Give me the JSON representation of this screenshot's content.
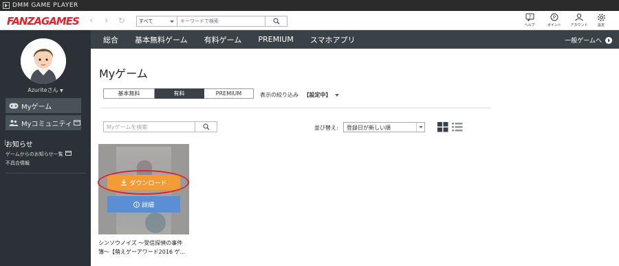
{
  "window": {
    "title": "DMM GAME PLAYER"
  },
  "brand": {
    "logo": "FANZAGAMES",
    "color": "#e3212c"
  },
  "search": {
    "category": "すべて",
    "placeholder": "キーワードで検索"
  },
  "header_icons": [
    {
      "icon": "help-icon",
      "label": "ヘルプ"
    },
    {
      "icon": "point-icon",
      "label": "ポイント"
    },
    {
      "icon": "account-icon",
      "label": "アカウント"
    },
    {
      "icon": "settings-icon",
      "label": "設定"
    }
  ],
  "sidebar": {
    "username": "Azuriteさん",
    "menu": [
      {
        "icon": "gamepad-icon",
        "label": "Myゲーム"
      },
      {
        "icon": "community-icon",
        "label": "Myコミュニティ"
      }
    ],
    "notice_title": "お知らせ",
    "notice_links": [
      "ゲームからのお知らせ一覧",
      "不具合情報"
    ]
  },
  "nav": {
    "items": [
      "総合",
      "基本無料ゲーム",
      "有料ゲーム",
      "PREMIUM",
      "スマホアプリ"
    ],
    "right_link": "一般ゲームへ"
  },
  "main": {
    "title": "Myゲーム",
    "filter_tabs": [
      "基本無料",
      "有料",
      "PREMIUM"
    ],
    "active_tab": "有料",
    "filter_label": "表示の絞り込み",
    "filter_status": "【設定中】",
    "search_placeholder": "Myゲームを検索",
    "sort_label": "並び替え:",
    "sort_value": "登録日が新しい順"
  },
  "game": {
    "download_label": "ダウンロード",
    "detail_label": "詳細",
    "title_line1": "シンソウノイズ 〜受信探偵の事件",
    "title_line2": "簿〜【萌えゲーアワード2016 ゲ..."
  },
  "colors": {
    "sidebar_bg": "#2b3136",
    "nav_bg": "#3b4247",
    "download": "#f39b35",
    "detail": "#5a8fd6",
    "highlight_ring": "#d6252a"
  }
}
